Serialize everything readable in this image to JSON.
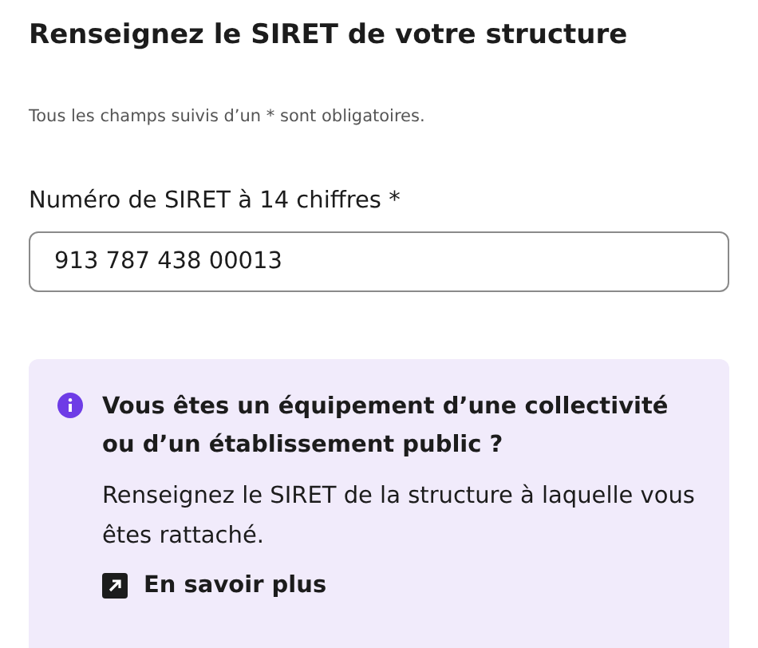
{
  "heading": "Renseignez le SIRET de votre structure",
  "required_note": "Tous les champs suivis d’un * sont obligatoires.",
  "siret_field": {
    "label": "Numéro de SIRET à 14 chiffres *",
    "value": "913 787 438 00013"
  },
  "callout": {
    "title": "Vous êtes un équipement d’une collectivité ou d’un établissement public ?",
    "body": "Renseignez le SIRET de la structure à laquelle vous êtes rattaché.",
    "link": "En savoir plus"
  }
}
